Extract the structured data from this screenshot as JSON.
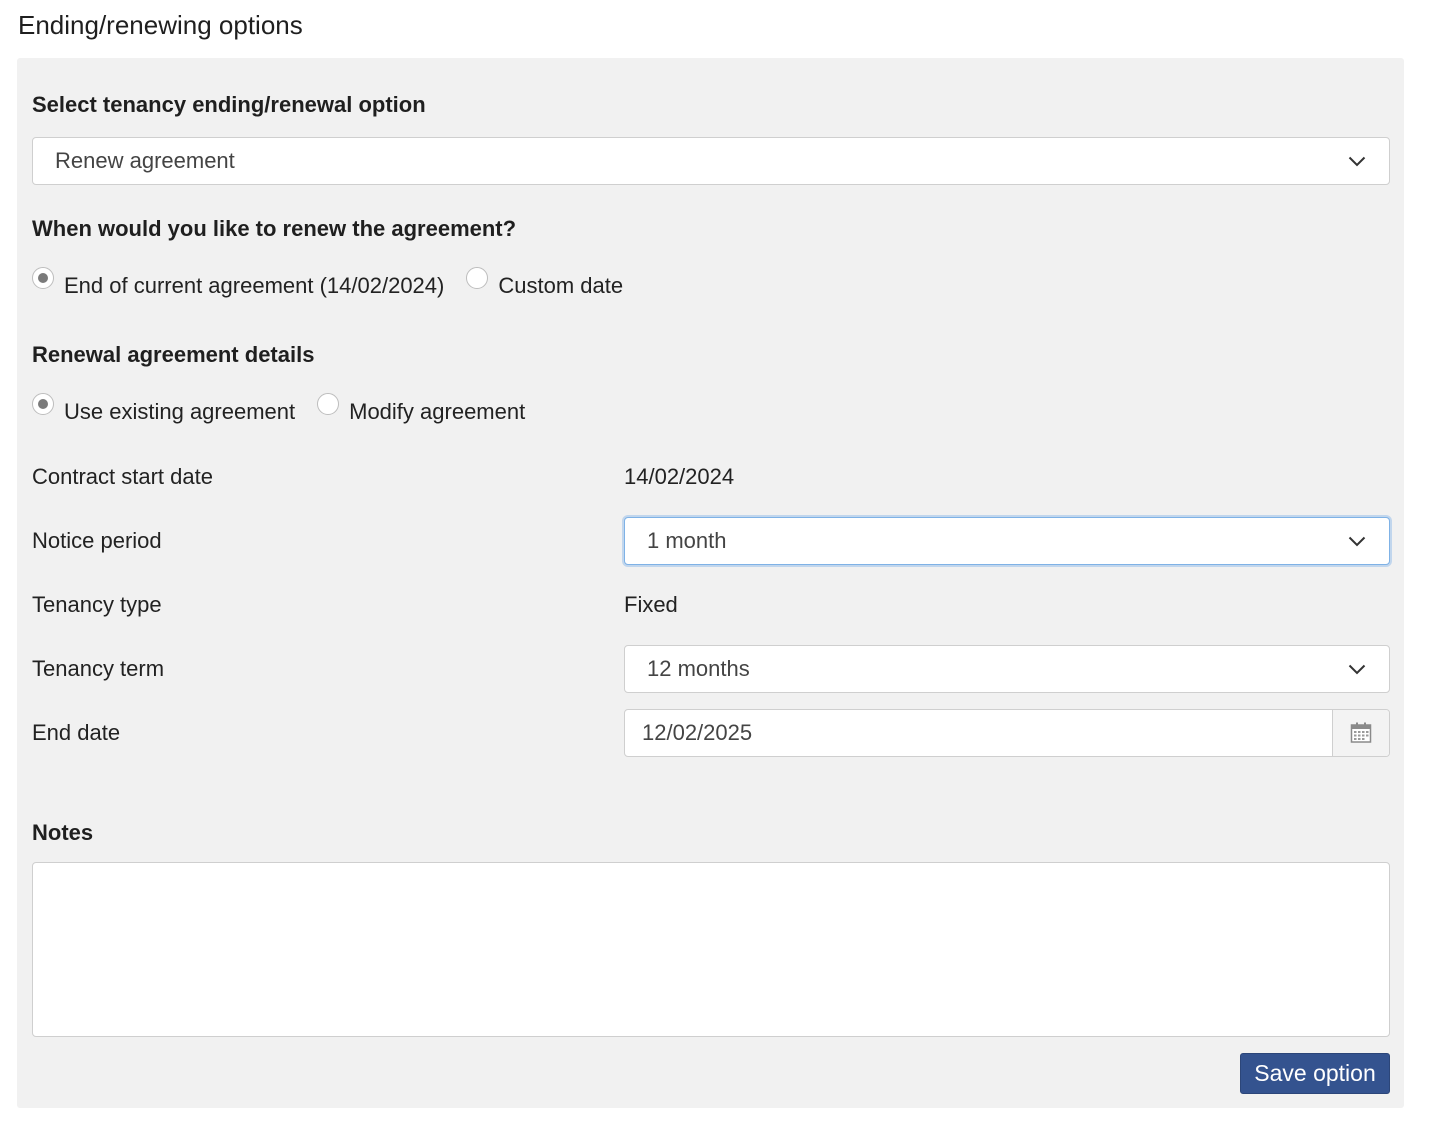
{
  "page": {
    "title": "Ending/renewing options"
  },
  "option_select": {
    "label": "Select tenancy ending/renewal option",
    "value": "Renew agreement"
  },
  "renew_when": {
    "label": "When would you like to renew the agreement?",
    "options": [
      {
        "label": "End of current agreement (14/02/2024)",
        "checked": true
      },
      {
        "label": "Custom date",
        "checked": false
      }
    ]
  },
  "renewal_details": {
    "label": "Renewal agreement details",
    "options": [
      {
        "label": "Use existing agreement",
        "checked": true
      },
      {
        "label": "Modify agreement",
        "checked": false
      }
    ]
  },
  "fields": {
    "contract_start": {
      "label": "Contract start date",
      "value": "14/02/2024"
    },
    "notice_period": {
      "label": "Notice period",
      "value": "1 month"
    },
    "tenancy_type": {
      "label": "Tenancy type",
      "value": "Fixed"
    },
    "tenancy_term": {
      "label": "Tenancy term",
      "value": "12 months"
    },
    "end_date": {
      "label": "End date",
      "value": "12/02/2025",
      "icon": "calendar-icon"
    }
  },
  "notes": {
    "label": "Notes",
    "value": ""
  },
  "actions": {
    "save_label": "Save option"
  },
  "colors": {
    "panel_bg": "#f1f1f1",
    "primary_button": "#34538f",
    "focus_border": "#7fb2e6"
  }
}
